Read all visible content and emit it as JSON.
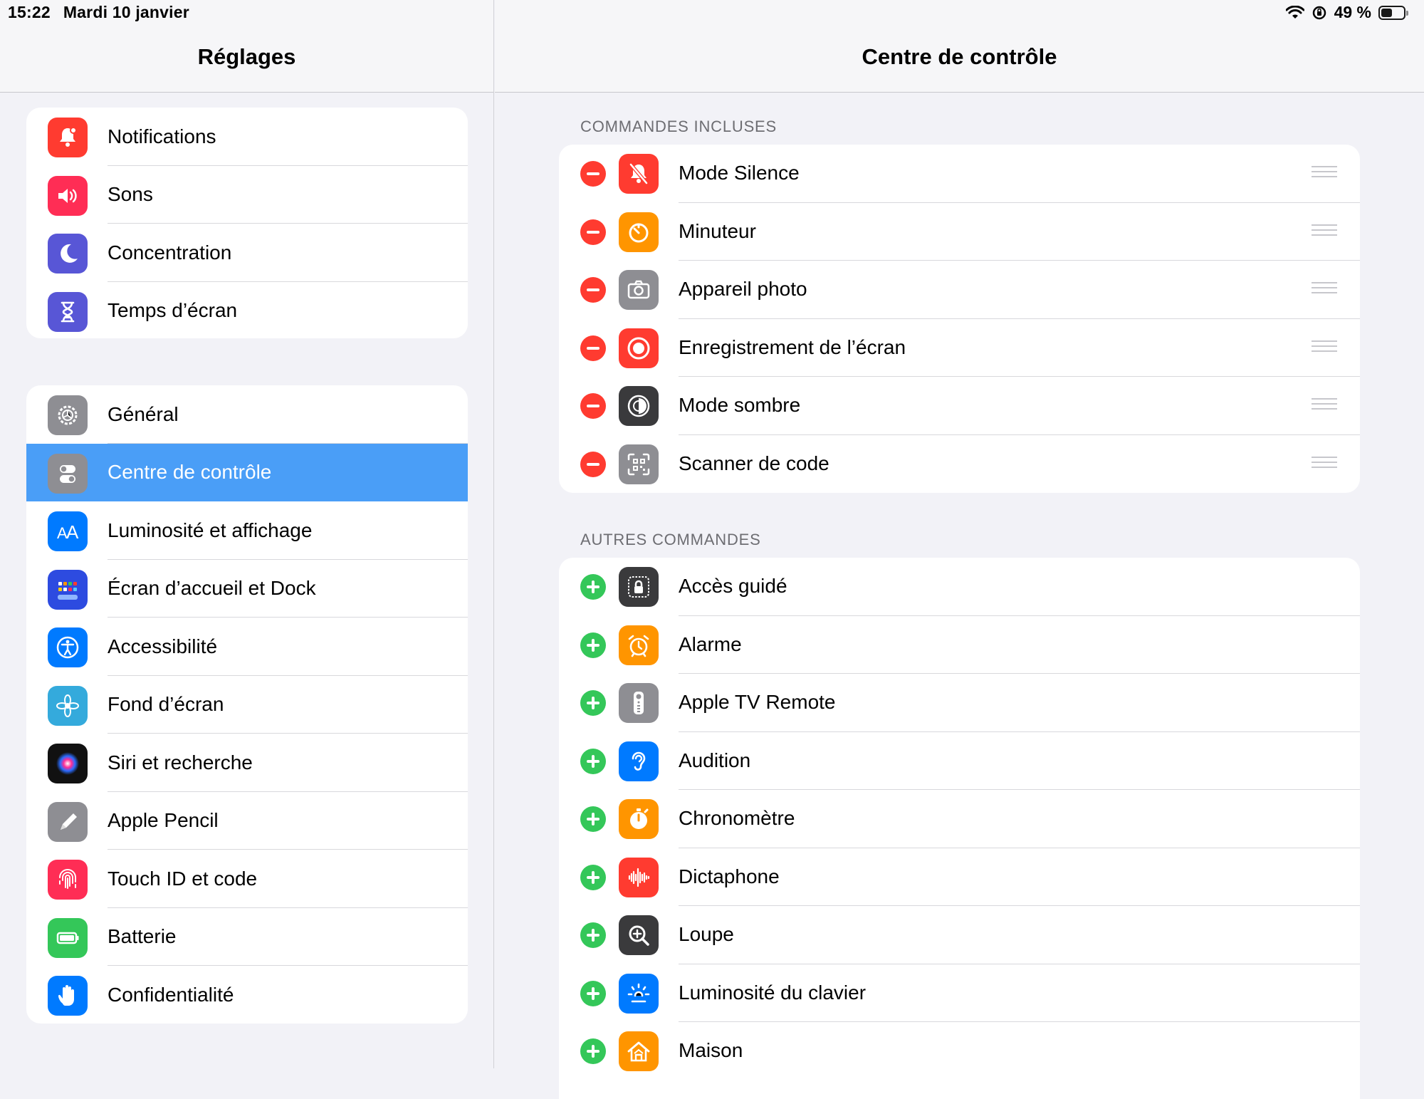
{
  "status": {
    "time": "15:22",
    "date": "Mardi 10 janvier",
    "battery": "49 %",
    "battery_level": 0.49
  },
  "sidebar": {
    "title": "Réglages",
    "group1": [
      {
        "label": "Notifications",
        "icon": "bell-icon",
        "color": "#ff3b30"
      },
      {
        "label": "Sons",
        "icon": "speaker-icon",
        "color": "#ff2d55"
      },
      {
        "label": "Concentration",
        "icon": "moon-icon",
        "color": "#5856d6"
      },
      {
        "label": "Temps d’écran",
        "icon": "hourglass-icon",
        "color": "#5856d6"
      }
    ],
    "group2": [
      {
        "label": "Général",
        "icon": "gear-icon",
        "color": "#8e8e93"
      },
      {
        "label": "Centre de contrôle",
        "icon": "toggles-icon",
        "color": "#8e8e93",
        "selected": true
      },
      {
        "label": "Luminosité et affichage",
        "icon": "text-size-icon",
        "color": "#007aff"
      },
      {
        "label": "Écran d’accueil et Dock",
        "icon": "app-grid-icon",
        "color": "#2d4be0"
      },
      {
        "label": "Accessibilité",
        "icon": "accessibility-icon",
        "color": "#007aff"
      },
      {
        "label": "Fond d’écran",
        "icon": "flower-icon",
        "color": "#34aadc"
      },
      {
        "label": "Siri et recherche",
        "icon": "siri-icon",
        "color": "#111111"
      },
      {
        "label": "Apple Pencil",
        "icon": "pencil-icon",
        "color": "#8e8e93"
      },
      {
        "label": "Touch ID et code",
        "icon": "fingerprint-icon",
        "color": "#ff2d55"
      },
      {
        "label": "Batterie",
        "icon": "battery-icon",
        "color": "#34c759"
      },
      {
        "label": "Confidentialité",
        "icon": "hand-icon",
        "color": "#007aff"
      }
    ]
  },
  "main": {
    "title": "Centre de contrôle",
    "included_header": "COMMANDES INCLUSES",
    "included": [
      {
        "label": "Mode Silence",
        "icon": "bell-slash-icon",
        "color": "#ff3b30"
      },
      {
        "label": "Minuteur",
        "icon": "timer-icon",
        "color": "#ff9500"
      },
      {
        "label": "Appareil photo",
        "icon": "camera-icon",
        "color": "#8e8e93"
      },
      {
        "label": "Enregistrement de l’écran",
        "icon": "record-icon",
        "color": "#ff3b30"
      },
      {
        "label": "Mode sombre",
        "icon": "dark-mode-icon",
        "color": "#3a3a3c"
      },
      {
        "label": "Scanner de code",
        "icon": "qr-code-icon",
        "color": "#8e8e93"
      }
    ],
    "other_header": "AUTRES COMMANDES",
    "other": [
      {
        "label": "Accès guidé",
        "icon": "lock-icon",
        "color": "#3a3a3c"
      },
      {
        "label": "Alarme",
        "icon": "alarm-icon",
        "color": "#ff9500"
      },
      {
        "label": "Apple TV Remote",
        "icon": "remote-icon",
        "color": "#8e8e93"
      },
      {
        "label": "Audition",
        "icon": "ear-icon",
        "color": "#007aff"
      },
      {
        "label": "Chronomètre",
        "icon": "stopwatch-icon",
        "color": "#ff9500"
      },
      {
        "label": "Dictaphone",
        "icon": "waveform-icon",
        "color": "#ff3b30"
      },
      {
        "label": "Loupe",
        "icon": "magnifier-icon",
        "color": "#3a3a3c"
      },
      {
        "label": "Luminosité du clavier",
        "icon": "keyboard-light-icon",
        "color": "#007aff"
      },
      {
        "label": "Maison",
        "icon": "home-icon",
        "color": "#ff9500"
      }
    ]
  }
}
